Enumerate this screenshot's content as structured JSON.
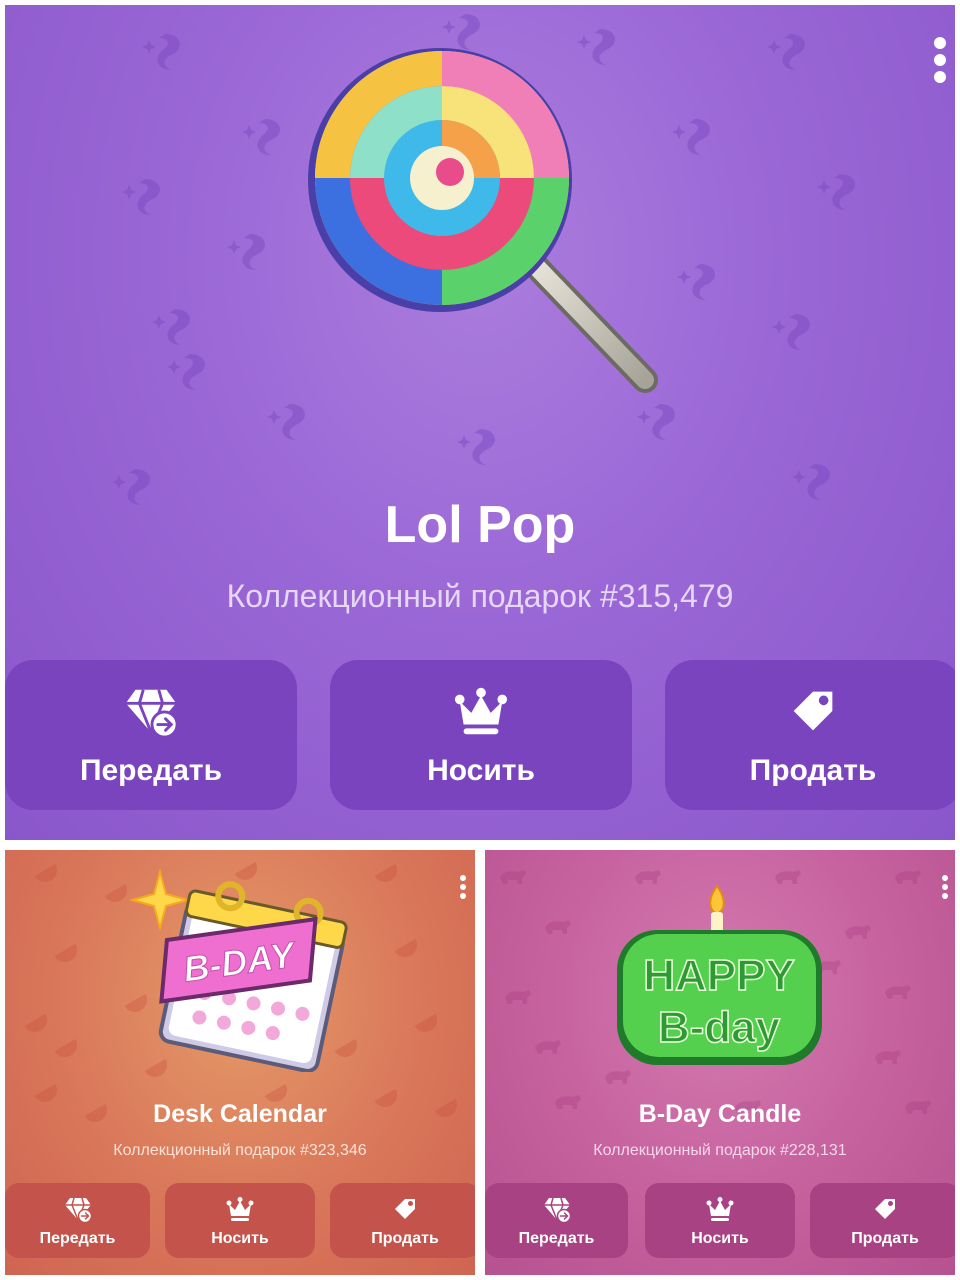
{
  "gifts": [
    {
      "name": "Lol Pop",
      "subtitle": "Коллекционный подарок #315,479",
      "buttons": [
        {
          "label": "Передать",
          "icon": "diamond-transfer-icon"
        },
        {
          "label": "Носить",
          "icon": "crown-icon"
        },
        {
          "label": "Продать",
          "icon": "price-tag-icon"
        }
      ],
      "background_color": "#9a67d6",
      "pattern_icon": "sparkle-swirl-icon",
      "art_icon": "lollipop-icon"
    },
    {
      "name": "Desk Calendar",
      "subtitle": "Коллекционный подарок #323,346",
      "art_text": "B-DAY",
      "buttons": [
        {
          "label": "Передать",
          "icon": "diamond-transfer-icon"
        },
        {
          "label": "Носить",
          "icon": "crown-icon"
        },
        {
          "label": "Продать",
          "icon": "price-tag-icon"
        }
      ],
      "background_color": "#d9775a",
      "pattern_icon": "orange-slice-icon",
      "art_icon": "desk-calendar-icon"
    },
    {
      "name": "B-Day Candle",
      "subtitle": "Коллекционный подарок #228,131",
      "art_text_line1": "HAPPY",
      "art_text_line2": "B-day",
      "buttons": [
        {
          "label": "Передать",
          "icon": "diamond-transfer-icon"
        },
        {
          "label": "Носить",
          "icon": "crown-icon"
        },
        {
          "label": "Продать",
          "icon": "price-tag-icon"
        }
      ],
      "background_color": "#c5619d",
      "pattern_icon": "bear-icon",
      "art_icon": "birthday-candle-icon"
    }
  ]
}
